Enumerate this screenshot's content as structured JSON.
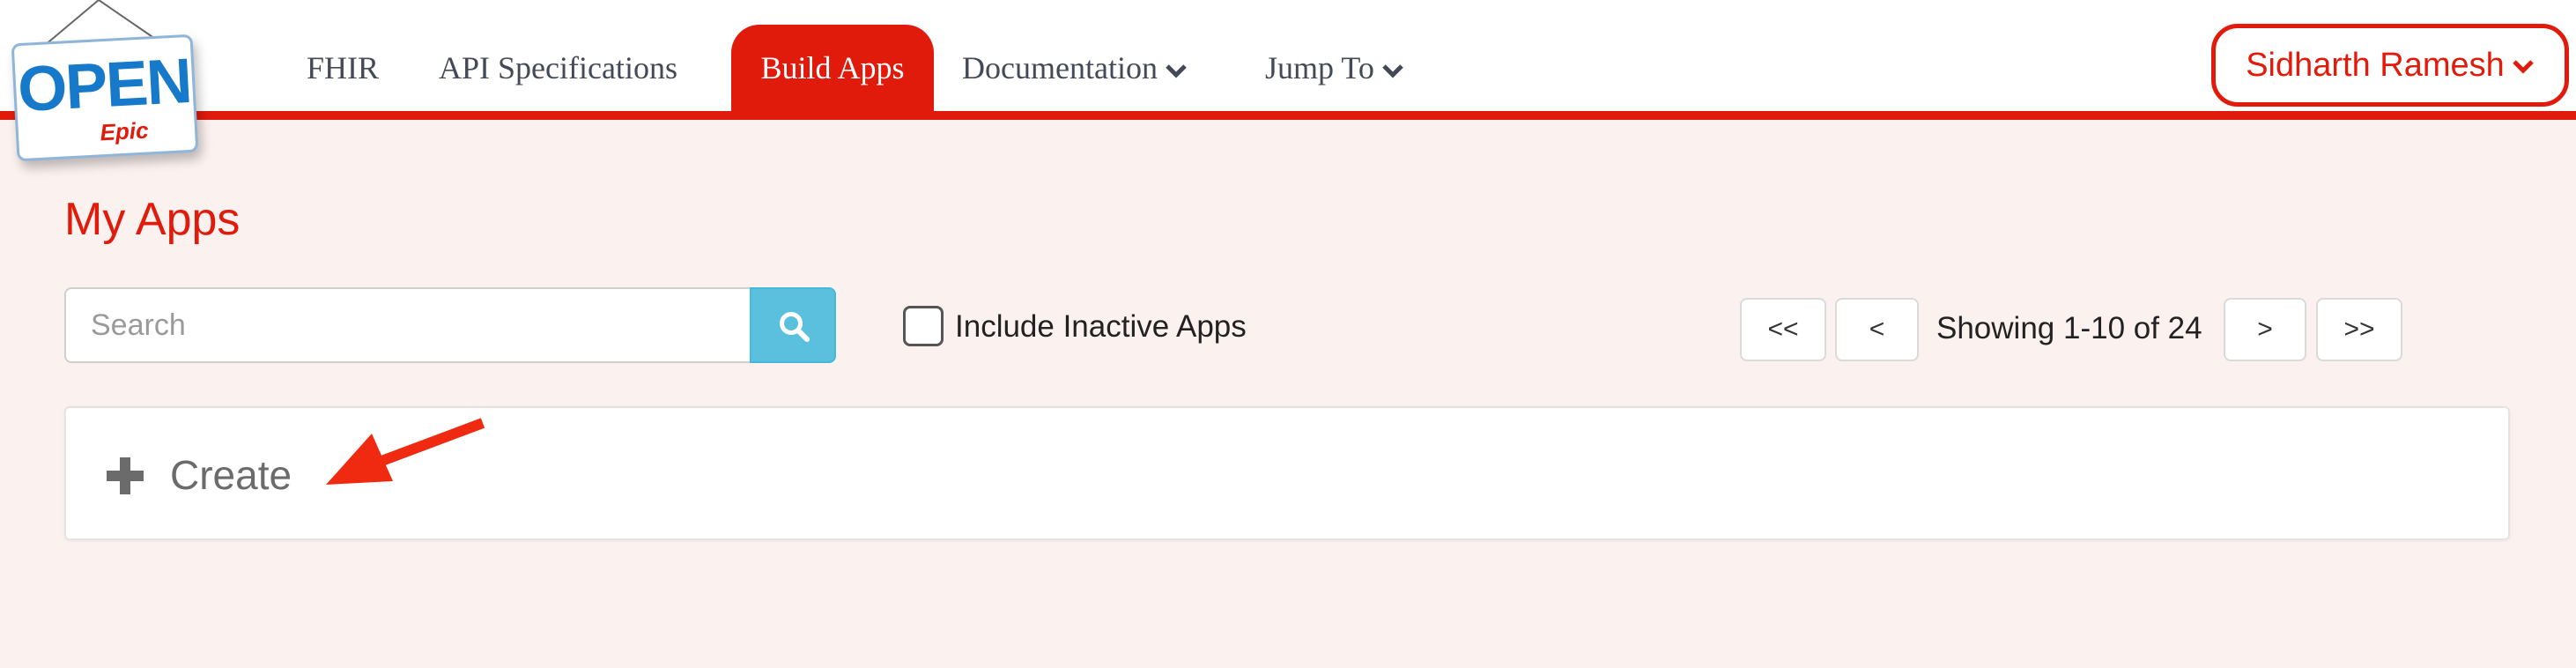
{
  "logo": {
    "line1": "OPEN",
    "line2": "Epic"
  },
  "nav": {
    "items": [
      {
        "label": "FHIR"
      },
      {
        "label": "API Specifications"
      },
      {
        "label": "Build Apps"
      },
      {
        "label": "Documentation"
      },
      {
        "label": "Jump To"
      }
    ]
  },
  "user": {
    "name": "Sidharth Ramesh"
  },
  "page": {
    "title": "My Apps"
  },
  "search": {
    "placeholder": "Search",
    "value": ""
  },
  "filter": {
    "include_inactive_label": "Include Inactive Apps",
    "checked": false
  },
  "pagination": {
    "first_label": "<<",
    "prev_label": "<",
    "info": "Showing 1-10 of 24",
    "next_label": ">",
    "last_label": ">>"
  },
  "create": {
    "label": "Create"
  },
  "colors": {
    "brand_red": "#e11b0c",
    "search_button": "#5bc0de",
    "background": "#fbf1ef"
  },
  "icons": {
    "search": "search-icon",
    "chevron": "chevron-down-icon",
    "plus": "plus-icon",
    "annotation": "red-arrow-icon"
  }
}
